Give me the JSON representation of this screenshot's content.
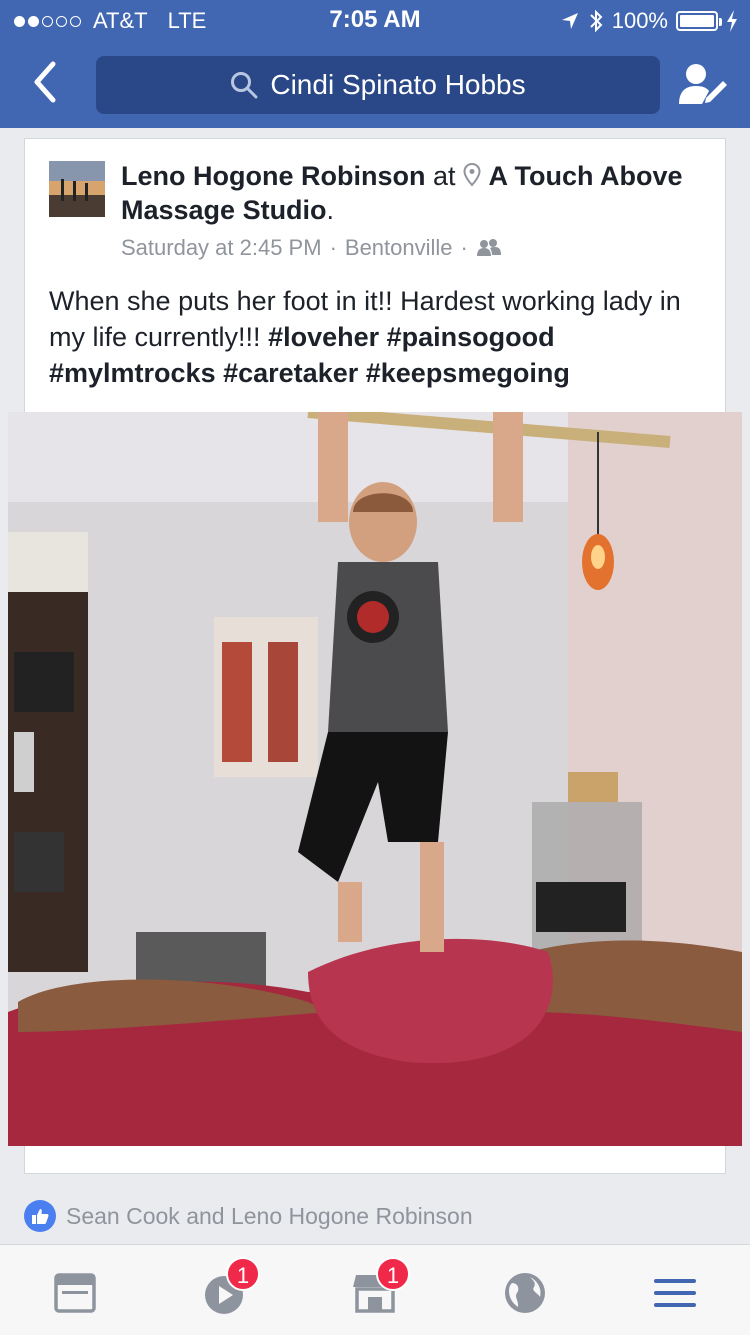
{
  "status_bar": {
    "carrier": "AT&T",
    "network": "LTE",
    "time": "7:05 AM",
    "battery": "100%"
  },
  "nav": {
    "search_text": "Cindi Spinato Hobbs",
    "back_icon": "chevron-left-icon",
    "friend_icon": "edit-friend-icon"
  },
  "post": {
    "author": "Leno Hogone Robinson",
    "at_word": "at",
    "place": "A Touch Above Massage Studio",
    "date": "Saturday at 2:45 PM",
    "location": "Bentonville",
    "caption_text": "When she puts her foot in it!!  Hardest working lady in my life currently!!!",
    "hashtags": [
      "#loveher",
      "#painsogood",
      "#mylmtrocks",
      "#caretaker",
      "#keepsmegoing"
    ]
  },
  "likes": {
    "text": "Sean Cook and Leno Hogone Robinson"
  },
  "tabbar": {
    "video_badge": "1",
    "marketplace_badge": "1"
  },
  "colors": {
    "brand": "#4267b2",
    "badge": "#f02849",
    "tab_icon": "#8d949e",
    "tab_active": "#4267b2"
  }
}
